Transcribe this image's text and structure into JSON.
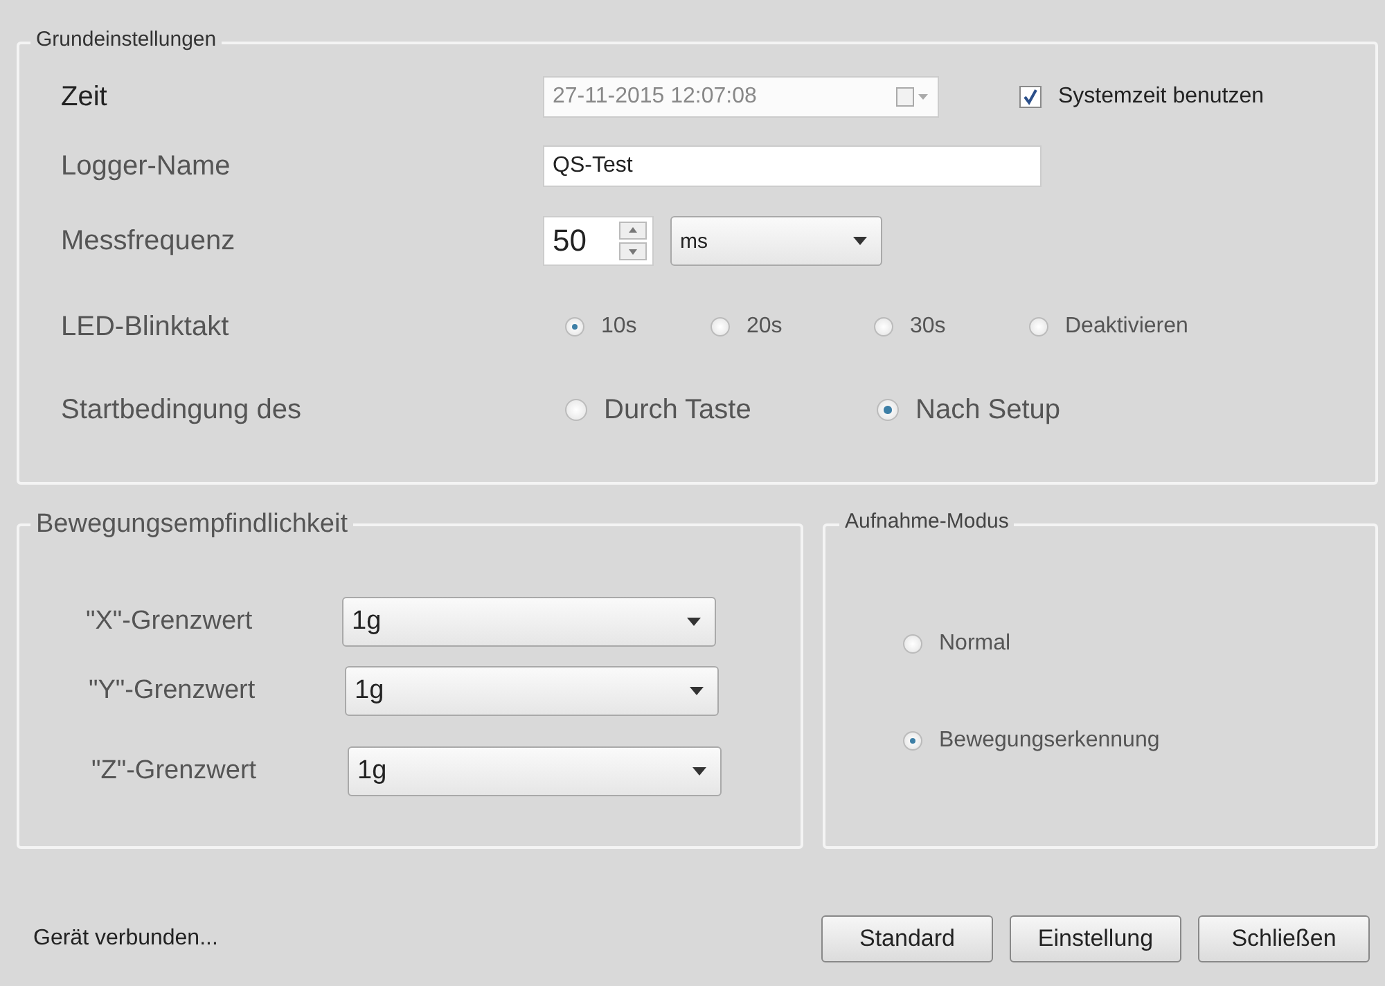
{
  "basic_settings": {
    "title": "Grundeinstellungen",
    "time": {
      "label": "Zeit",
      "value": "27-11-2015 12:07:08",
      "disabled": true
    },
    "system_time": {
      "label": "Systemzeit benutzen",
      "checked": true
    },
    "logger_name": {
      "label": "Logger-Name",
      "value": "QS-Test"
    },
    "frequency": {
      "label": "Messfrequenz",
      "value": "50",
      "unit": "ms"
    },
    "led_blink": {
      "label": "LED-Blinktakt",
      "options": [
        {
          "label": "10s",
          "selected": true
        },
        {
          "label": "20s",
          "selected": false
        },
        {
          "label": "30s",
          "selected": false
        },
        {
          "label": "Deaktivieren",
          "selected": false
        }
      ]
    },
    "start_condition": {
      "label": "Startbedingung des",
      "options": [
        {
          "label": "Durch Taste",
          "selected": false
        },
        {
          "label": "Nach Setup",
          "selected": true
        }
      ]
    }
  },
  "motion_sensitivity": {
    "title": "Bewegungsempfindlichkeit",
    "thresholds": [
      {
        "label": "\"X\"-Grenzwert",
        "value": "1g"
      },
      {
        "label": "\"Y\"-Grenzwert",
        "value": "1g"
      },
      {
        "label": "\"Z\"-Grenzwert",
        "value": "1g"
      }
    ]
  },
  "recording_mode": {
    "title": "Aufnahme-Modus",
    "options": [
      {
        "label": "Normal",
        "selected": false
      },
      {
        "label": "Bewegungserkennung",
        "selected": true
      }
    ]
  },
  "status_bar": {
    "text": "Gerät verbunden..."
  },
  "buttons": [
    "Standard",
    "Einstellung",
    "Schließen"
  ]
}
